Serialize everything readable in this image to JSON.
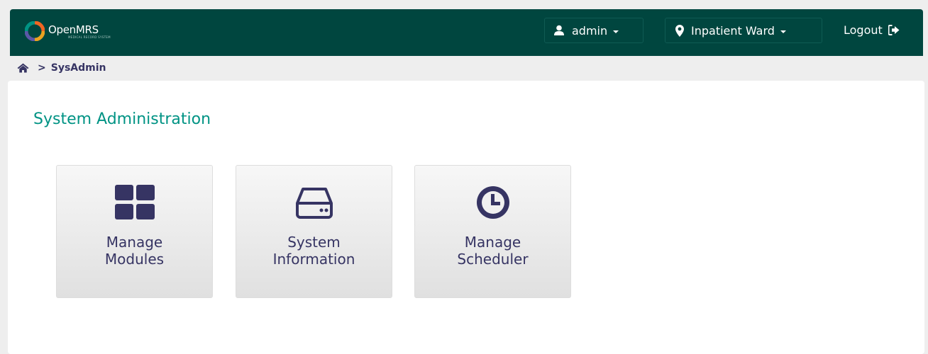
{
  "header": {
    "logo": {
      "name": "OpenMRS",
      "tagline": "MEDICAL RECORD SYSTEM"
    },
    "user_button": {
      "label": "admin",
      "icon": "user-icon"
    },
    "location_button": {
      "label": "Inpatient Ward",
      "icon": "map-marker-icon"
    },
    "logout": {
      "label": "Logout",
      "icon": "sign-out-icon"
    },
    "background_color": "#00463f"
  },
  "breadcrumb": {
    "home_icon": "home-icon",
    "separator": ">",
    "current": "SysAdmin"
  },
  "main": {
    "title": "System Administration",
    "title_color": "#009384",
    "tiles": [
      {
        "label": "Manage\nModules",
        "icon": "grid-icon"
      },
      {
        "label": "System\nInformation",
        "icon": "hard-drive-icon"
      },
      {
        "label": "Manage\nScheduler",
        "icon": "clock-icon"
      }
    ]
  }
}
